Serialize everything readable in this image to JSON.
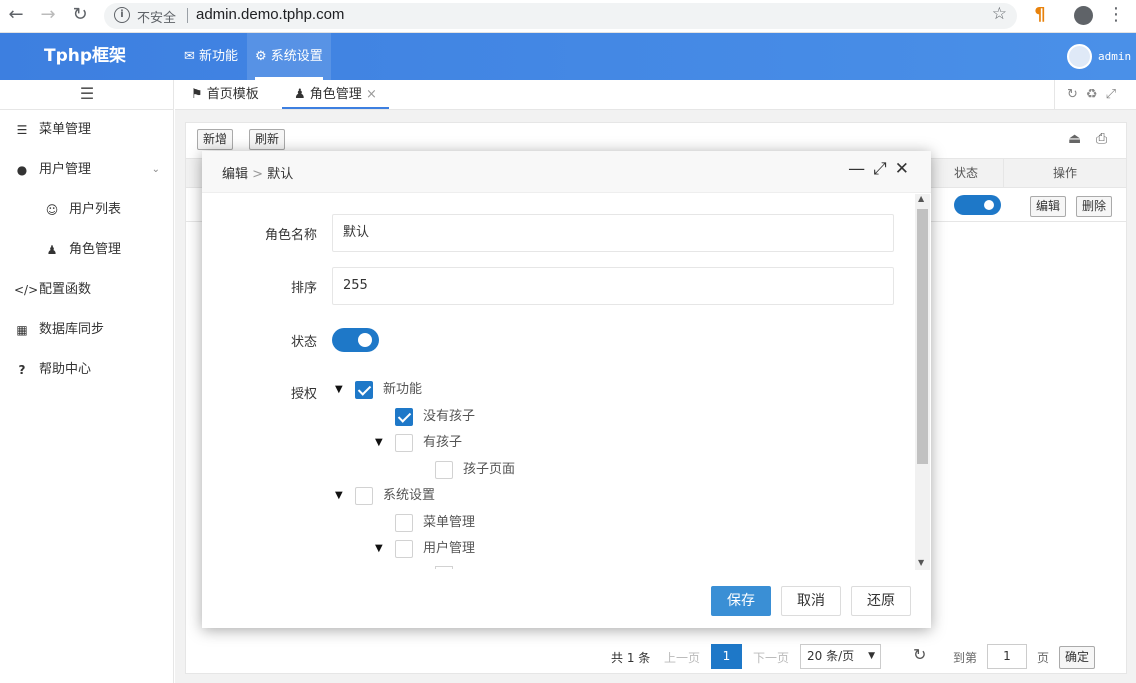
{
  "browser": {
    "insecure_label": "不安全",
    "url": "admin.demo.tphp.com"
  },
  "header": {
    "logo": "Tphp框架",
    "nav": [
      "新功能",
      "系统设置"
    ],
    "active_nav": "系统设置",
    "username": "admin"
  },
  "sidebar": {
    "items": [
      {
        "label": "菜单管理",
        "icon": "menu-icon"
      },
      {
        "label": "用户管理",
        "icon": "user-icon",
        "expanded": true
      },
      {
        "label": "用户列表",
        "icon": "person-outline-icon"
      },
      {
        "label": "角色管理",
        "icon": "person-standing-icon"
      },
      {
        "label": "配置函数",
        "icon": "code-icon"
      },
      {
        "label": "数据库同步",
        "icon": "table-icon"
      },
      {
        "label": "帮助中心",
        "icon": "question-icon"
      }
    ]
  },
  "tabs": [
    {
      "label": "首页模板",
      "icon": "flag-icon"
    },
    {
      "label": "角色管理",
      "icon": "person-standing-icon",
      "close": "×"
    }
  ],
  "toolbar": {
    "add": "新增",
    "refresh": "刷新"
  },
  "table": {
    "headers": {
      "status": "状态",
      "actions": "操作"
    },
    "row": {
      "edit": "编辑",
      "delete": "删除",
      "status_on": true
    }
  },
  "pager": {
    "total": "共 1 条",
    "prev": "上一页",
    "page": "1",
    "next": "下一页",
    "per_page": "20 条/页",
    "goto": "到第",
    "goto_value": "1",
    "page_unit": "页",
    "confirm": "确定"
  },
  "modal": {
    "breadcrumb": "编辑",
    "breadcrumb_sep": ">",
    "breadcrumb_current": "默认",
    "fields": {
      "name_label": "角色名称",
      "name_value": "默认",
      "sort_label": "排序",
      "sort_value": "255",
      "status_label": "状态",
      "auth_label": "授权"
    },
    "tree": [
      {
        "label": "新功能",
        "checked": true,
        "level": 0,
        "expand": true
      },
      {
        "label": "没有孩子",
        "checked": true,
        "level": 1,
        "expand": false
      },
      {
        "label": "有孩子",
        "checked": false,
        "level": 1,
        "expand": true
      },
      {
        "label": "孩子页面",
        "checked": false,
        "level": 2,
        "expand": false
      },
      {
        "label": "系统设置",
        "checked": false,
        "level": 0,
        "expand": true
      },
      {
        "label": "菜单管理",
        "checked": false,
        "level": 1,
        "expand": false
      },
      {
        "label": "用户管理",
        "checked": false,
        "level": 1,
        "expand": true
      }
    ],
    "buttons": {
      "save": "保存",
      "cancel": "取消",
      "reset": "还原"
    }
  }
}
